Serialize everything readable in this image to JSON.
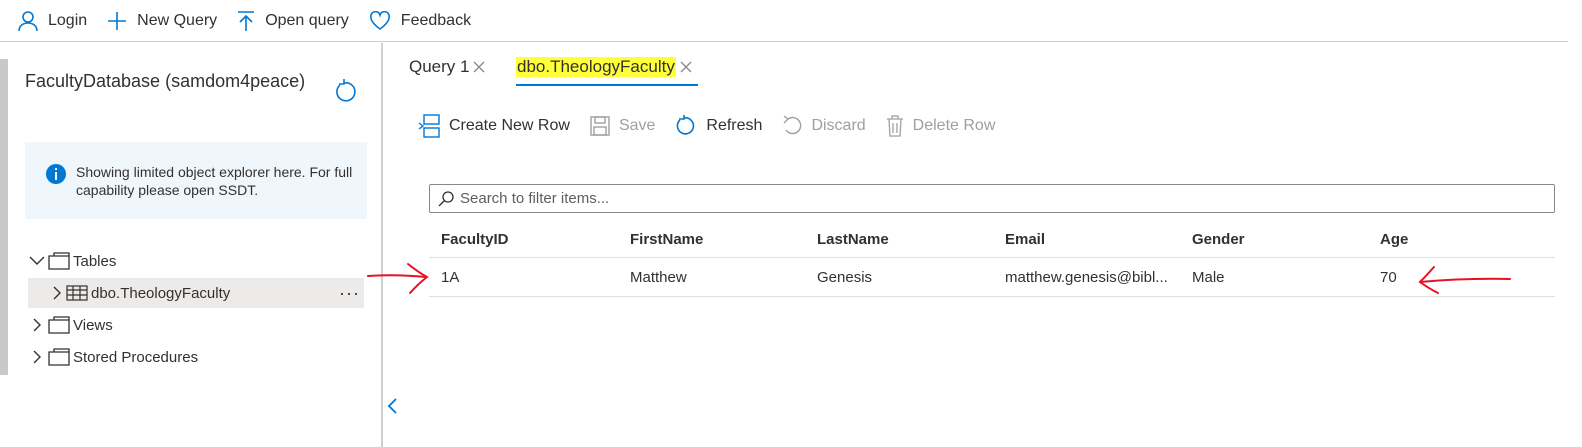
{
  "topbar": {
    "items": [
      {
        "label": "Login",
        "icon": "person-icon"
      },
      {
        "label": "New Query",
        "icon": "plus-icon"
      },
      {
        "label": "Open query",
        "icon": "upload-icon"
      },
      {
        "label": "Feedback",
        "icon": "heart-icon"
      }
    ]
  },
  "sidebar": {
    "db_title": "FacultyDatabase (samdom4peace)",
    "info_text": "Showing limited object explorer here. For full capability please open SSDT.",
    "tree": {
      "tables": "Tables",
      "table_item": "dbo.TheologyFaculty",
      "more": "···",
      "views": "Views",
      "procedures": "Stored Procedures"
    }
  },
  "tabs": [
    {
      "label": "Query 1"
    },
    {
      "label": "dbo.TheologyFaculty",
      "active": true
    }
  ],
  "toolbar": {
    "create": "Create New Row",
    "save": "Save",
    "refresh": "Refresh",
    "discard": "Discard",
    "delete": "Delete Row"
  },
  "search": {
    "placeholder": "Search to filter items..."
  },
  "grid": {
    "columns": [
      "FacultyID",
      "FirstName",
      "LastName",
      "Email",
      "Gender",
      "Age"
    ],
    "rows": [
      [
        "1A",
        "Matthew",
        "Genesis",
        "matthew.genesis@bibl...",
        "Male",
        "70"
      ]
    ]
  },
  "colors": {
    "accent": "#0078d4",
    "highlight": "#ffff3a",
    "annotation": "#e81123",
    "info_bg": "#eff6fc"
  }
}
